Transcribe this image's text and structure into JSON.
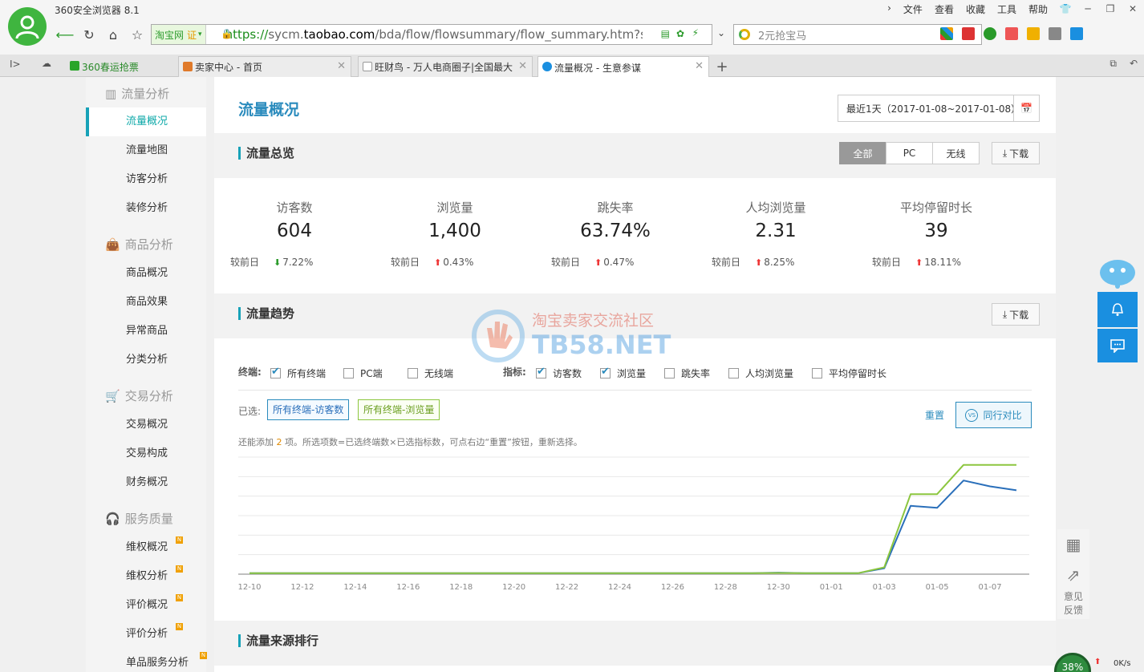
{
  "browser": {
    "title": "360安全浏览器 8.1",
    "menu": [
      "文件",
      "查看",
      "收藏",
      "工具",
      "帮助"
    ],
    "site_badge": "淘宝网",
    "site_badge_cert": "证",
    "url_scheme": "https://",
    "url_pre": "sycm.",
    "url_host": "taobao.com",
    "url_path": "/bda/flow/flowsummary/flow_summary.htm?spn",
    "search_placeholder": "2元抢宝马",
    "tabs": [
      {
        "label": "360春运抢票",
        "color": "#2aa52a"
      },
      {
        "label": "卖家中心 - 首页",
        "color": "#e07a2a"
      },
      {
        "label": "旺财鸟 - 万人电商圈子|全国最大",
        "color": "#888888"
      },
      {
        "label": "流量概况 - 生意参谋",
        "color": "#1a8fe0"
      }
    ]
  },
  "sidebar": {
    "groups": [
      {
        "label": "流量分析",
        "items": [
          "流量概况",
          "流量地图",
          "访客分析",
          "装修分析"
        ]
      },
      {
        "label": "商品分析",
        "items": [
          "商品概况",
          "商品效果",
          "异常商品",
          "分类分析"
        ]
      },
      {
        "label": "交易分析",
        "items": [
          "交易概况",
          "交易构成",
          "财务概况"
        ]
      },
      {
        "label": "服务质量",
        "items": [
          "维权概况",
          "维权分析",
          "评价概况",
          "评价分析",
          "单品服务分析"
        ]
      }
    ],
    "new_badge": "N"
  },
  "page": {
    "title": "流量概况",
    "date_range": "最近1天（2017-01-08~2017-01-08）",
    "overview_title": "流量总览",
    "segments": [
      "全部",
      "PC",
      "无线"
    ],
    "download": "下载",
    "kpis": [
      {
        "label": "访客数",
        "value": "604",
        "cmp_label": "较前日",
        "dir": "down",
        "pct": "7.22%"
      },
      {
        "label": "浏览量",
        "value": "1,400",
        "cmp_label": "较前日",
        "dir": "up",
        "pct": "0.43%"
      },
      {
        "label": "跳失率",
        "value": "63.74%",
        "cmp_label": "较前日",
        "dir": "up",
        "pct": "0.47%"
      },
      {
        "label": "人均浏览量",
        "value": "2.31",
        "cmp_label": "较前日",
        "dir": "up",
        "pct": "8.25%"
      },
      {
        "label": "平均停留时长",
        "value": "39",
        "cmp_label": "较前日",
        "dir": "up",
        "pct": "18.11%"
      }
    ],
    "trend_title": "流量趋势",
    "terminal_label": "终端:",
    "terminals": [
      {
        "label": "所有终端",
        "checked": true
      },
      {
        "label": "PC端",
        "checked": false
      },
      {
        "label": "无线端",
        "checked": false
      }
    ],
    "metric_label": "指标:",
    "metrics": [
      {
        "label": "访客数",
        "checked": true
      },
      {
        "label": "浏览量",
        "checked": true
      },
      {
        "label": "跳失率",
        "checked": false
      },
      {
        "label": "人均浏览量",
        "checked": false
      },
      {
        "label": "平均停留时长",
        "checked": false
      }
    ],
    "selected_label": "已选:",
    "selected_tags": [
      "所有终端-访客数",
      "所有终端-浏览量"
    ],
    "reset": "重置",
    "compare": "同行对比",
    "hint_pre": "还能添加 ",
    "hint_num": "2",
    "hint_post": " 项。所选项数=已选终端数×已选指标数，可点右边“重置”按钮，重新选择。",
    "source_title": "流量来源排行"
  },
  "chart_data": {
    "type": "line",
    "x": [
      "12-10",
      "12-11",
      "12-12",
      "12-13",
      "12-14",
      "12-15",
      "12-16",
      "12-17",
      "12-18",
      "12-19",
      "12-20",
      "12-21",
      "12-22",
      "12-23",
      "12-24",
      "12-25",
      "12-26",
      "12-27",
      "12-28",
      "12-29",
      "12-30",
      "12-31",
      "01-01",
      "01-02",
      "01-03",
      "01-04",
      "01-05",
      "01-06",
      "01-07",
      "01-08"
    ],
    "x_tick_labels": [
      "12-10",
      "12-12",
      "12-14",
      "12-16",
      "12-18",
      "12-20",
      "12-22",
      "12-24",
      "12-26",
      "12-28",
      "12-30",
      "01-01",
      "01-03",
      "01-05",
      "01-07"
    ],
    "series": [
      {
        "name": "所有终端-访客数",
        "color": "#2a6fba",
        "values": [
          5,
          5,
          5,
          5,
          5,
          5,
          5,
          5,
          5,
          5,
          5,
          5,
          5,
          5,
          5,
          5,
          5,
          5,
          5,
          5,
          8,
          5,
          5,
          5,
          30,
          350,
          340,
          480,
          450,
          430
        ]
      },
      {
        "name": "所有终端-浏览量",
        "color": "#8cc63f",
        "values": [
          5,
          5,
          5,
          5,
          5,
          5,
          5,
          5,
          5,
          5,
          5,
          5,
          5,
          5,
          5,
          5,
          5,
          5,
          5,
          5,
          6,
          5,
          5,
          5,
          35,
          410,
          410,
          560,
          560,
          560
        ]
      }
    ],
    "ylim": [
      0,
      600
    ],
    "grid": true,
    "legend": "none"
  },
  "float": {
    "feedback": [
      "意见",
      "反馈"
    ],
    "progress": "38%",
    "speed": "0K/s"
  },
  "watermark": {
    "cn": "淘宝卖家交流社区",
    "en": "TB58.NET"
  }
}
